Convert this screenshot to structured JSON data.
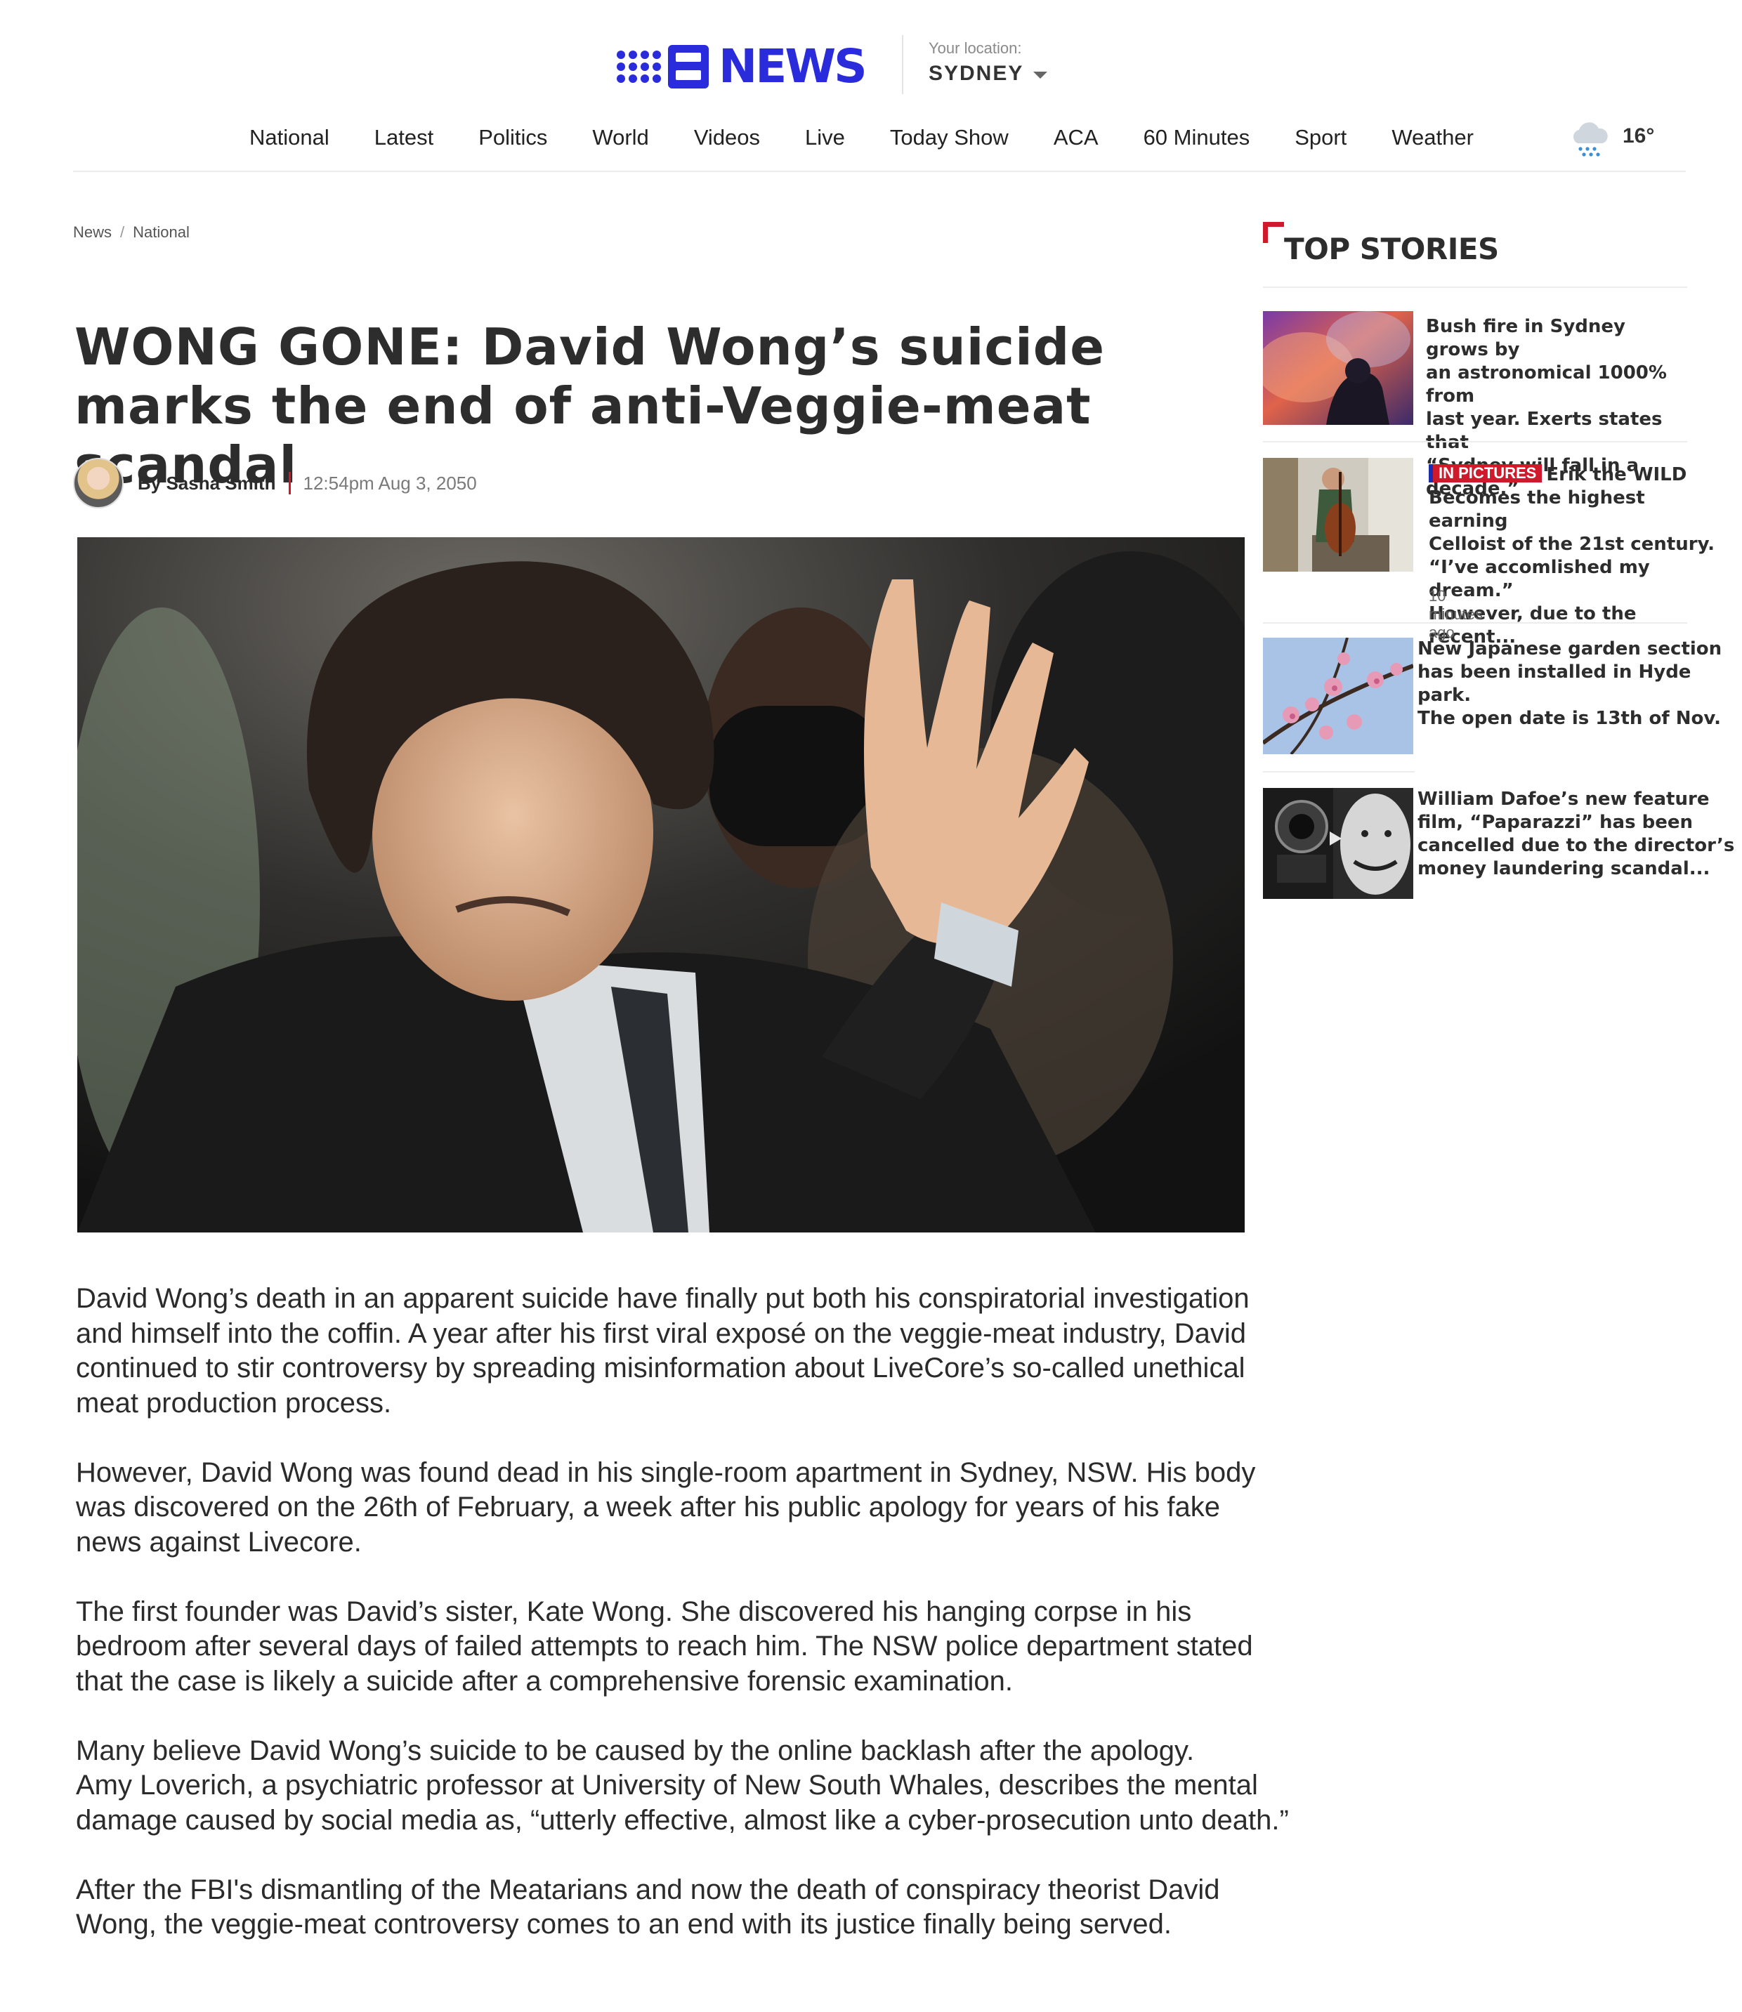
{
  "brand": {
    "logo_text": "NEWS",
    "logo_color": "#2a2bdb"
  },
  "location": {
    "label": "Your location:",
    "value": "SYDNEY"
  },
  "nav": {
    "items": [
      {
        "label": "National"
      },
      {
        "label": "Latest"
      },
      {
        "label": "Politics"
      },
      {
        "label": "World"
      },
      {
        "label": "Videos"
      },
      {
        "label": "Live"
      },
      {
        "label": "Today Show"
      },
      {
        "label": "ACA"
      },
      {
        "label": "60 Minutes"
      },
      {
        "label": "Sport"
      },
      {
        "label": "Weather"
      }
    ]
  },
  "weather": {
    "icon": "rain-cloud-icon",
    "temp": "16°"
  },
  "breadcrumb": {
    "items": [
      "News",
      "National"
    ],
    "separator": "/"
  },
  "article": {
    "headline": "WONG GONE: David Wong’s suicide marks the end of anti-Veggie-meat scandal",
    "author": "By Sasha Smith",
    "timestamp": "12:54pm Aug 3, 2050",
    "paragraphs": [
      "David Wong’s death in an apparent suicide have finally put both his conspiratorial investigation\nand himself into the coffin. A year after his first viral exposé on the veggie-meat industry, David\ncontinued to stir controversy by spreading misinformation about LiveCore’s so-called unethical\nmeat production process.",
      "However, David Wong was found dead in his single-room apartment in Sydney, NSW. His body\nwas discovered on the 26th of February, a week after his public apology for years of his fake\nnews against Livecore.",
      "The first founder was David’s sister, Kate Wong. She discovered his hanging corpse in his\nbedroom after several days of failed attempts to reach him. The NSW police department stated\nthat the case is likely a suicide after a comprehensive forensic examination.",
      "Many believe David Wong’s suicide to be caused by the online backlash after the apology.\nAmy Loverich, a psychiatric professor at University of New South Whales, describes the mental\ndamage caused by social media as, “utterly effective, almost like a cyber-prosecution unto death.”",
      "After the FBI's dismantling of the Meatarians and now the death of conspiracy theorist David\nWong, the veggie-meat controversy comes to an end with its justice finally being served."
    ]
  },
  "sidebar": {
    "title": "TOP STORIES",
    "accent": "#d0192a",
    "stories": [
      {
        "text": "Bush fire in Sydney grows by\nan astronomical 1000% from\nlast year. Exerts states that\n“Sydney will fall in a decade.”"
      },
      {
        "tag": "IN PICTURES",
        "text": "Erik the WILD\nBecomes the highest earning\nCelloist of the 21st century.\n“I’ve accomlished my dream.”\nHowever, due to the recent...",
        "ago": "10 minutes ago"
      },
      {
        "text": "New Japanese garden section\nhas been installed in Hyde park.\nThe open date is 13th of Nov."
      },
      {
        "text": "William Dafoe’s new feature\nfilm, “Paparazzi” has been\ncancelled due to the director’s\nmoney laundering scandal..."
      }
    ]
  }
}
